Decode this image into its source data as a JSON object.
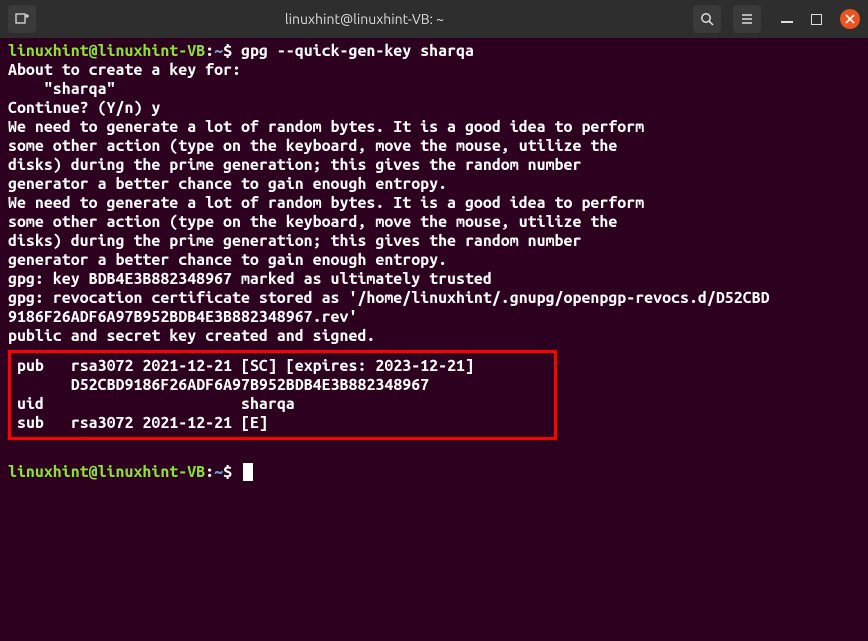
{
  "titlebar": {
    "title": "linuxhint@linuxhint-VB: ~"
  },
  "terminal": {
    "prompt1": {
      "user": "linuxhint@linuxhint-VB",
      "colon": ":",
      "path": "~",
      "dollar": "$",
      "command": " gpg --quick-gen-key sharqa"
    },
    "lines": [
      "About to create a key for:",
      "    \"sharqa\"",
      "",
      "Continue? (Y/n) y",
      "We need to generate a lot of random bytes. It is a good idea to perform",
      "some other action (type on the keyboard, move the mouse, utilize the",
      "disks) during the prime generation; this gives the random number",
      "generator a better chance to gain enough entropy.",
      "We need to generate a lot of random bytes. It is a good idea to perform",
      "some other action (type on the keyboard, move the mouse, utilize the",
      "disks) during the prime generation; this gives the random number",
      "generator a better chance to gain enough entropy.",
      "gpg: key BDB4E3B882348967 marked as ultimately trusted",
      "gpg: revocation certificate stored as '/home/linuxhint/.gnupg/openpgp-revocs.d/D52CBD",
      "9186F26ADF6A97B952BDB4E3B882348967.rev'",
      "public and secret key created and signed."
    ],
    "keyinfo": [
      "pub   rsa3072 2021-12-21 [SC] [expires: 2023-12-21]",
      "      D52CBD9186F26ADF6A97B952BDB4E3B882348967",
      "uid                      sharqa",
      "sub   rsa3072 2021-12-21 [E]"
    ],
    "prompt2": {
      "user": "linuxhint@linuxhint-VB",
      "colon": ":",
      "path": "~",
      "dollar": "$"
    }
  }
}
